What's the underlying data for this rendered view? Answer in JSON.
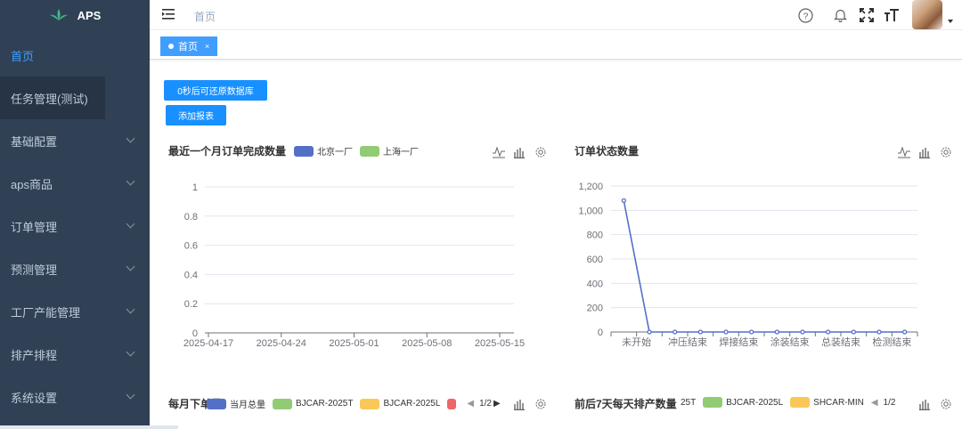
{
  "app": {
    "name": "APS"
  },
  "sidebar": {
    "items": [
      {
        "label": "首页"
      },
      {
        "label": "任务管理(测试)"
      },
      {
        "label": "基础配置"
      },
      {
        "label": "aps商品"
      },
      {
        "label": "订单管理"
      },
      {
        "label": "预测管理"
      },
      {
        "label": "工厂产能管理"
      },
      {
        "label": "排产排程"
      },
      {
        "label": "系统设置"
      }
    ]
  },
  "navbar": {
    "breadcrumb": "首页",
    "icons": [
      "menu-toggle-icon",
      "help-icon",
      "bell-icon",
      "fullscreen-icon",
      "font-size-icon"
    ]
  },
  "tags": [
    {
      "label": "首页",
      "close": "×"
    }
  ],
  "actions": {
    "restore_label": "0秒后可还原数据库",
    "add_report_label": "添加报表"
  },
  "colors": {
    "sidebar_bg": "#304156",
    "primary": "#1890ff",
    "series_blue": "#5470c6",
    "series_green": "#91cc75",
    "series_yellow": "#fac858",
    "series_red": "#ee6666"
  },
  "chart_data": [
    {
      "type": "line",
      "title": "最近一个月订单完成数量",
      "series": [
        {
          "name": "北京一厂",
          "values": []
        },
        {
          "name": "上海一厂",
          "values": []
        }
      ],
      "x": [
        "2025-04-17",
        "2025-04-24",
        "2025-05-01",
        "2025-05-08",
        "2025-05-15"
      ],
      "ylim": [
        0,
        1
      ],
      "yticks": [
        "0",
        "0.2",
        "0.4",
        "0.6",
        "0.8",
        "1"
      ],
      "grid": true
    },
    {
      "type": "line",
      "title": "订单状态数量",
      "categories": [
        "未开始",
        "",
        "冲压结束",
        "",
        "焊接结束",
        "",
        "涂装结束",
        "",
        "总装结束",
        "",
        "检测结束",
        ""
      ],
      "values": [
        1080,
        0,
        0,
        0,
        0,
        0,
        0,
        0,
        0,
        0,
        0,
        0
      ],
      "ylim": [
        0,
        1200
      ],
      "yticks": [
        "0",
        "200",
        "400",
        "600",
        "800",
        "1,000",
        "1,200"
      ],
      "grid": true
    },
    {
      "type": "bar",
      "title": "每月下单量",
      "legend": [
        "当月总量",
        "BJCAR-2025T",
        "BJCAR-2025L"
      ],
      "page": "1/2"
    },
    {
      "type": "bar",
      "title": "前后7天每天排产数量",
      "legend": [
        "25T",
        "BJCAR-2025L",
        "SHCAR-MIN"
      ],
      "page": "1/2"
    }
  ]
}
